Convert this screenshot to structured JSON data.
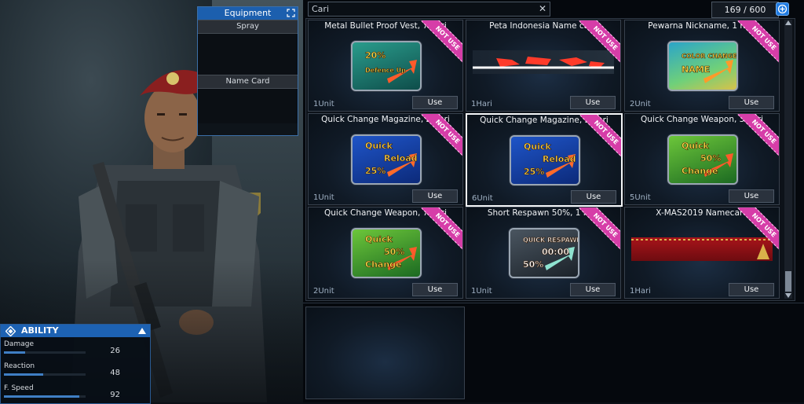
{
  "equipment": {
    "title": "Equipment",
    "slots": [
      {
        "label": "Spray"
      },
      {
        "label": "Name Card"
      }
    ]
  },
  "ability": {
    "title": "ABILITY",
    "stats": [
      {
        "label": "Damage",
        "value": "26",
        "fill": 0.26
      },
      {
        "label": "Reaction",
        "value": "48",
        "fill": 0.48
      },
      {
        "label": "F. Speed",
        "value": "92",
        "fill": 0.92
      }
    ]
  },
  "search": {
    "text": "Cari",
    "clear_glyph": "✕"
  },
  "counter": "169 / 600",
  "ribbon_label": "NOT USE",
  "use_label": "Use",
  "items": [
    {
      "title": "Metal Bullet Proof Vest, 7 hari",
      "qty": "1Unit",
      "icon": "defence-up-icon",
      "icon_lines": [
        "20%",
        "Defence Up"
      ]
    },
    {
      "title": "Peta Indonesia Name card",
      "qty": "1Hari",
      "icon": "indonesia-map-namecard-icon",
      "icon_lines": []
    },
    {
      "title": "Pewarna Nickname, 1 hari",
      "qty": "2Unit",
      "icon": "color-change-name-icon",
      "icon_lines": [
        "COLOR CHANGE",
        "NAME"
      ]
    },
    {
      "title": "Quick Change Magazine, 2 hari",
      "qty": "1Unit",
      "icon": "quick-reload-icon",
      "icon_lines": [
        "Quick",
        "Reload",
        "25%"
      ]
    },
    {
      "title": "Quick Change Magazine, 3 hari",
      "qty": "6Unit",
      "icon": "quick-reload-icon",
      "icon_lines": [
        "Quick",
        "Reload",
        "25%"
      ]
    },
    {
      "title": "Quick Change Weapon, 3 hari",
      "qty": "5Unit",
      "icon": "quick-change-weapon-icon",
      "icon_lines": [
        "Quick",
        "50%",
        "Change"
      ]
    },
    {
      "title": "Quick Change Weapon, 7 hari",
      "qty": "2Unit",
      "icon": "quick-change-weapon-icon",
      "icon_lines": [
        "Quick",
        "50%",
        "Change"
      ]
    },
    {
      "title": "Short Respawn 50%, 1 hari",
      "qty": "1Unit",
      "icon": "quick-respawn-icon",
      "icon_lines": [
        "QUICK RESPAWN",
        "00:00",
        "50%"
      ]
    },
    {
      "title": "X-MAS2019 Namecard",
      "qty": "1Hari",
      "icon": "xmas-namecard-icon",
      "icon_lines": []
    }
  ],
  "colors": {
    "accent_blue": "#1d62b3",
    "ribbon_pink": "#d63da8",
    "selected_border": "#f3f5f7"
  }
}
